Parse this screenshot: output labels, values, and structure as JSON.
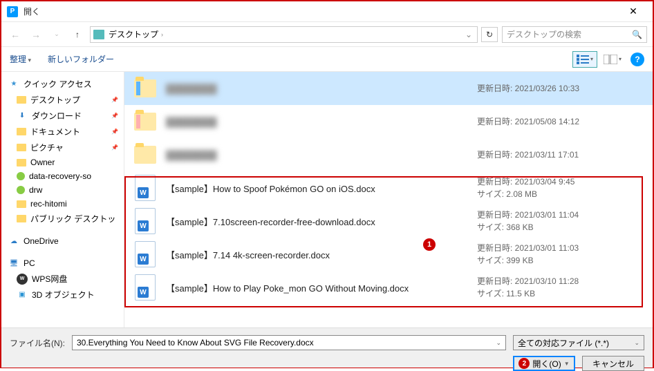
{
  "title": "開く",
  "address": "デスクトップ",
  "search_placeholder": "デスクトップの検索",
  "toolbar": {
    "organize": "整理",
    "new_folder": "新しいフォルダー"
  },
  "sidebar": {
    "quick_access": "クイック アクセス",
    "items_q": [
      "デスクトップ",
      "ダウンロード",
      "ドキュメント",
      "ピクチャ",
      "Owner",
      "data-recovery-so",
      "drw",
      "rec-hitomi",
      "パブリック デスクトッ"
    ],
    "onedrive": "OneDrive",
    "pc": "PC",
    "pc_items": [
      "WPS网盘",
      "3D オブジェクト"
    ]
  },
  "files": [
    {
      "name": "blurred-1",
      "meta1": "更新日時: 2021/03/26 10:33",
      "meta2": "",
      "type": "folder-blue",
      "blur": true,
      "sel": true
    },
    {
      "name": "blurred-2",
      "meta1": "更新日時: 2021/05/08 14:12",
      "meta2": "",
      "type": "folder-pink",
      "blur": true
    },
    {
      "name": "blurred-3",
      "meta1": "更新日時: 2021/03/11 17:01",
      "meta2": "",
      "type": "folder",
      "blur": true
    },
    {
      "name": "【sample】How to Spoof Pokémon GO on iOS.docx",
      "meta1": "更新日時: 2021/03/04 9:45",
      "meta2": "サイズ: 2.08 MB",
      "type": "docx"
    },
    {
      "name": "【sample】7.10screen-recorder-free-download.docx",
      "meta1": "更新日時: 2021/03/01 11:04",
      "meta2": "サイズ: 368 KB",
      "type": "docx"
    },
    {
      "name": "【sample】7.14 4k-screen-recorder.docx",
      "meta1": "更新日時: 2021/03/01 11:03",
      "meta2": "サイズ: 399 KB",
      "type": "docx"
    },
    {
      "name": "【sample】How to Play Poke_mon GO Without Moving.docx",
      "meta1": "更新日時: 2021/03/10 11:28",
      "meta2": "サイズ: 11.5 KB",
      "type": "docx"
    }
  ],
  "filename_label": "ファイル名(N):",
  "filename_value": "30.Everything You Need to Know About SVG File Recovery.docx",
  "filter": "全ての対応ファイル (*.*)",
  "btn_open": "開く(O)",
  "btn_cancel": "キャンセル",
  "annot": {
    "one": "1",
    "two": "2"
  }
}
